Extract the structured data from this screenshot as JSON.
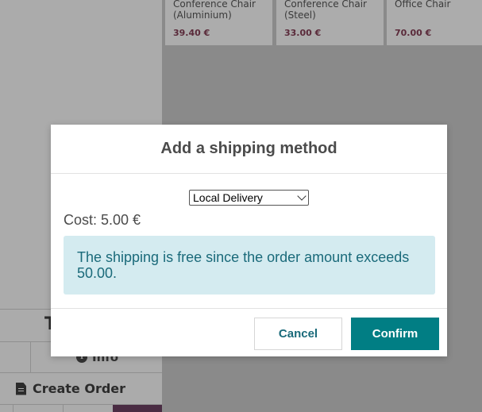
{
  "products": [
    {
      "name": "Conference Chair (Aluminium)",
      "price": "39.40 €"
    },
    {
      "name": "Conference Chair (Steel)",
      "price": "33.00 €"
    },
    {
      "name": "Office Chair",
      "price": "70.00 €"
    }
  ],
  "left_panel": {
    "total_partial": "T",
    "info_label": "Info",
    "create_order_label": "Create Order"
  },
  "modal": {
    "title": "Add a shipping method",
    "shipping_select_value": "Local Delivery",
    "cost_text": "Cost: 5.00 €",
    "alert_text": "The shipping is free since the order amount exceeds 50.00.",
    "cancel_label": "Cancel",
    "confirm_label": "Confirm"
  },
  "colors": {
    "accent": "#017e84",
    "alert_bg": "#d4ebf0",
    "alert_text": "#1a6a7a"
  },
  "icons": {
    "info": "info-circle-icon",
    "create_order": "document-icon",
    "select": "chevron-down-icon"
  }
}
